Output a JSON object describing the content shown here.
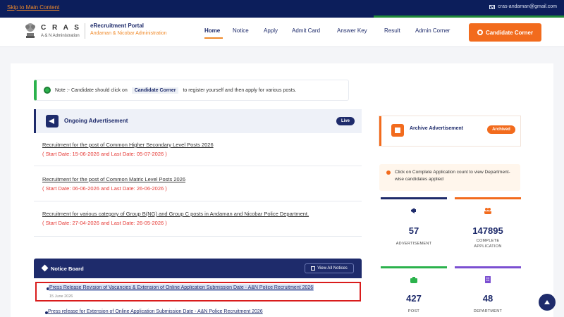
{
  "topbar": {
    "skip_link": "Skip to Main Content",
    "email": "cras-andaman@gmail.com"
  },
  "header": {
    "brand_name": "C R A S",
    "brand_sub": "A & N Administration",
    "portal_title": "eRecruitment Portal",
    "portal_sub": "Andaman & Nicobar Administration",
    "nav": [
      "Home",
      "Notice",
      "Apply",
      "Admit Card",
      "Answer Key",
      "Result",
      "Admin Corner"
    ],
    "active_nav": "Home",
    "candidate_button": "Candidate Corner"
  },
  "note": {
    "prefix": "Note :- Candidate should click on",
    "highlight": "Candidate Corner",
    "suffix": "to register yourself and then apply for various posts."
  },
  "ongoing": {
    "title": "Ongoing Advertisement",
    "badge": "Live",
    "items": [
      {
        "title": "Recruitment for the post of Common Higher Secondary Level Posts 2026",
        "dates": "( Start Date: 15-06-2026 and Last Date: 05-07-2026 )"
      },
      {
        "title": "Recruitment for the post of Common Matric Level Posts 2026",
        "dates": "( Start Date: 06-06-2026 and Last Date: 26-06-2026 )"
      },
      {
        "title": "Recruitment for various category of Group B(NG) and Group C posts in Andaman and Nicobar Police Department.",
        "dates": "( Start Date: 27-04-2026 and Last Date: 26-05-2026 )"
      }
    ]
  },
  "notice_board": {
    "title": "Notice Board",
    "view_all": "View All Notices",
    "items": [
      {
        "text": "Press Release Revision of Vacancies & Extension of Online Application Submission Date - A&N Police Recruitment 2026",
        "meta": "15 June 2026"
      },
      {
        "text": "Press release for Extension of Online Application Submission Date - A&N Police Recruitment 2026"
      }
    ]
  },
  "archive": {
    "title": "Archive Advertisement",
    "badge": "Archived"
  },
  "info": {
    "text": "Click on Complete Application count to view Department-wise candidates applied"
  },
  "stats": [
    {
      "value": "57",
      "label": "ADVERTISEMENT",
      "bar_color": "#1e2b6b",
      "icon": "megaphone-icon"
    },
    {
      "value": "147895",
      "label": "COMPLETE APPLICATION",
      "bar_color": "#f26b1d",
      "icon": "users-icon"
    },
    {
      "value": "427",
      "label": "POST",
      "bar_color": "#2bb24c",
      "icon": "briefcase-icon"
    },
    {
      "value": "48",
      "label": "DEPARTMENT",
      "bar_color": "#7b4fd1",
      "icon": "building-icon"
    }
  ]
}
